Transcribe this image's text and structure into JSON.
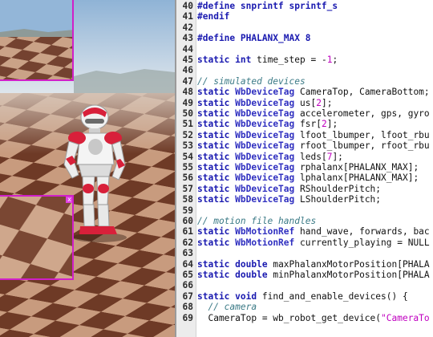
{
  "scene": {
    "name": "simulation-3d-view",
    "camera_top_close": "x",
    "camera_bottom_close": "x"
  },
  "editor": {
    "lines": [
      {
        "n": "40",
        "tokens": [
          [
            "pp",
            "#define snprintf sprintf_s"
          ]
        ]
      },
      {
        "n": "41",
        "tokens": [
          [
            "pp",
            "#endif"
          ]
        ]
      },
      {
        "n": "42",
        "tokens": []
      },
      {
        "n": "43",
        "tokens": [
          [
            "pp",
            "#define PHALANX_MAX 8"
          ]
        ]
      },
      {
        "n": "44",
        "tokens": []
      },
      {
        "n": "45",
        "tokens": [
          [
            "kw",
            "static"
          ],
          [
            "",
            " "
          ],
          [
            "kw",
            "int"
          ],
          [
            "",
            " time_step = -"
          ],
          [
            "num",
            "1"
          ],
          [
            "",
            ";"
          ]
        ]
      },
      {
        "n": "46",
        "tokens": []
      },
      {
        "n": "47",
        "tokens": [
          [
            "cm",
            "// simulated devices"
          ]
        ]
      },
      {
        "n": "48",
        "tokens": [
          [
            "kw",
            "static"
          ],
          [
            "",
            " "
          ],
          [
            "ty",
            "WbDeviceTag"
          ],
          [
            "",
            " CameraTop, CameraBottom;"
          ]
        ]
      },
      {
        "n": "49",
        "tokens": [
          [
            "kw",
            "static"
          ],
          [
            "",
            " "
          ],
          [
            "ty",
            "WbDeviceTag"
          ],
          [
            "",
            " us["
          ],
          [
            "num",
            "2"
          ],
          [
            "",
            "];"
          ]
        ]
      },
      {
        "n": "50",
        "tokens": [
          [
            "kw",
            "static"
          ],
          [
            "",
            " "
          ],
          [
            "ty",
            "WbDeviceTag"
          ],
          [
            "",
            " accelerometer, gps, gyro"
          ]
        ]
      },
      {
        "n": "51",
        "tokens": [
          [
            "kw",
            "static"
          ],
          [
            "",
            " "
          ],
          [
            "ty",
            "WbDeviceTag"
          ],
          [
            "",
            " fsr["
          ],
          [
            "num",
            "2"
          ],
          [
            "",
            "];"
          ]
        ]
      },
      {
        "n": "52",
        "tokens": [
          [
            "kw",
            "static"
          ],
          [
            "",
            " "
          ],
          [
            "ty",
            "WbDeviceTag"
          ],
          [
            "",
            " lfoot_lbumper, lfoot_rbu"
          ]
        ]
      },
      {
        "n": "53",
        "tokens": [
          [
            "kw",
            "static"
          ],
          [
            "",
            " "
          ],
          [
            "ty",
            "WbDeviceTag"
          ],
          [
            "",
            " rfoot_lbumper, rfoot_rbu"
          ]
        ]
      },
      {
        "n": "54",
        "tokens": [
          [
            "kw",
            "static"
          ],
          [
            "",
            " "
          ],
          [
            "ty",
            "WbDeviceTag"
          ],
          [
            "",
            " leds["
          ],
          [
            "num",
            "7"
          ],
          [
            "",
            "];"
          ]
        ]
      },
      {
        "n": "55",
        "tokens": [
          [
            "kw",
            "static"
          ],
          [
            "",
            " "
          ],
          [
            "ty",
            "WbDeviceTag"
          ],
          [
            "",
            " rphalanx[PHALANX_MAX];"
          ]
        ]
      },
      {
        "n": "56",
        "tokens": [
          [
            "kw",
            "static"
          ],
          [
            "",
            " "
          ],
          [
            "ty",
            "WbDeviceTag"
          ],
          [
            "",
            " lphalanx[PHALANX_MAX];"
          ]
        ]
      },
      {
        "n": "57",
        "tokens": [
          [
            "kw",
            "static"
          ],
          [
            "",
            " "
          ],
          [
            "ty",
            "WbDeviceTag"
          ],
          [
            "",
            " RShoulderPitch;"
          ]
        ]
      },
      {
        "n": "58",
        "tokens": [
          [
            "kw",
            "static"
          ],
          [
            "",
            " "
          ],
          [
            "ty",
            "WbDeviceTag"
          ],
          [
            "",
            " LShoulderPitch;"
          ]
        ]
      },
      {
        "n": "59",
        "tokens": []
      },
      {
        "n": "60",
        "tokens": [
          [
            "cm",
            "// motion file handles"
          ]
        ]
      },
      {
        "n": "61",
        "tokens": [
          [
            "kw",
            "static"
          ],
          [
            "",
            " "
          ],
          [
            "ty",
            "WbMotionRef"
          ],
          [
            "",
            " hand_wave, forwards, bac"
          ]
        ]
      },
      {
        "n": "62",
        "tokens": [
          [
            "kw",
            "static"
          ],
          [
            "",
            " "
          ],
          [
            "ty",
            "WbMotionRef"
          ],
          [
            "",
            " currently_playing = NULL"
          ]
        ]
      },
      {
        "n": "63",
        "tokens": []
      },
      {
        "n": "64",
        "tokens": [
          [
            "kw",
            "static"
          ],
          [
            "",
            " "
          ],
          [
            "kw",
            "double"
          ],
          [
            "",
            " maxPhalanxMotorPosition[PHALA"
          ]
        ]
      },
      {
        "n": "65",
        "tokens": [
          [
            "kw",
            "static"
          ],
          [
            "",
            " "
          ],
          [
            "kw",
            "double"
          ],
          [
            "",
            " minPhalanxMotorPosition[PHALA"
          ]
        ]
      },
      {
        "n": "66",
        "tokens": []
      },
      {
        "n": "67",
        "tokens": [
          [
            "kw",
            "static"
          ],
          [
            "",
            " "
          ],
          [
            "kw",
            "void"
          ],
          [
            "",
            " find_and_enable_devices() {"
          ]
        ]
      },
      {
        "n": "68",
        "tokens": [
          [
            "cm",
            "  // camera"
          ]
        ]
      },
      {
        "n": "69",
        "tokens": [
          [
            "",
            "  CameraTop = wb_robot_get_device("
          ],
          [
            "str",
            "\"CameraTo"
          ]
        ]
      }
    ]
  }
}
